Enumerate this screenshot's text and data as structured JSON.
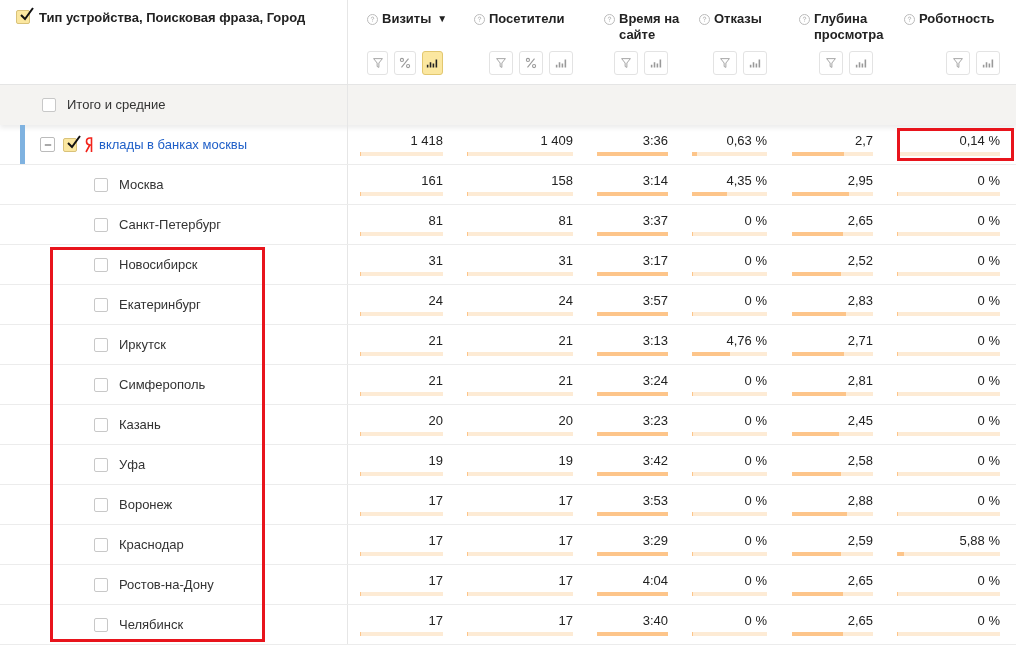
{
  "header": {
    "checked": true,
    "title": "Тип устройства, Поисковая фраза, Город",
    "columns": [
      {
        "label": "Визиты",
        "sort": "▼",
        "tools": [
          {
            "kind": "filter",
            "selected": false
          },
          {
            "kind": "percent",
            "selected": false
          },
          {
            "kind": "bars",
            "selected": true
          }
        ]
      },
      {
        "label": "Посетители",
        "tools": [
          {
            "kind": "filter",
            "selected": false
          },
          {
            "kind": "percent",
            "selected": false
          },
          {
            "kind": "bars",
            "selected": false
          }
        ]
      },
      {
        "label": "Время на сайте",
        "tools": [
          {
            "kind": "filter",
            "selected": false
          },
          {
            "kind": "bars",
            "selected": false
          }
        ]
      },
      {
        "label": "Отказы",
        "tools": [
          {
            "kind": "filter",
            "selected": false
          },
          {
            "kind": "bars",
            "selected": false
          }
        ]
      },
      {
        "label": "Глубина просмотра",
        "tools": [
          {
            "kind": "filter",
            "selected": false
          },
          {
            "kind": "bars",
            "selected": false
          }
        ]
      },
      {
        "label": "Роботность",
        "tools": [
          {
            "kind": "filter",
            "selected": false
          },
          {
            "kind": "bars",
            "selected": false
          }
        ]
      }
    ]
  },
  "totals": {
    "label": "Итого и средние",
    "checked": false
  },
  "rows": [
    {
      "kind": "phrase",
      "label": "вклады в банках москвы",
      "checked": true,
      "expanded": true,
      "framed": false,
      "cells": [
        {
          "value": "1 418",
          "level": 0
        },
        {
          "value": "1 409",
          "level": 0
        },
        {
          "value": "3:36",
          "level": 1
        },
        {
          "value": "0,63 %",
          "level": 0.07
        },
        {
          "value": "2,7",
          "level": 0.64
        },
        {
          "value": "0,14 %",
          "level": 0,
          "framed": true
        }
      ]
    },
    {
      "kind": "city",
      "label": "Москва",
      "checked": false,
      "framed": false,
      "cells": [
        {
          "value": "161",
          "level": 0
        },
        {
          "value": "158",
          "level": 0
        },
        {
          "value": "3:14",
          "level": 1
        },
        {
          "value": "4,35 %",
          "level": 0.47
        },
        {
          "value": "2,95",
          "level": 0.7
        },
        {
          "value": "0 %",
          "level": 0
        }
      ]
    },
    {
      "kind": "city",
      "label": "Санкт-Петербург",
      "checked": false,
      "framed": false,
      "cells": [
        {
          "value": "81",
          "level": 0
        },
        {
          "value": "81",
          "level": 0
        },
        {
          "value": "3:37",
          "level": 1
        },
        {
          "value": "0 %",
          "level": 0
        },
        {
          "value": "2,65",
          "level": 0.63
        },
        {
          "value": "0 %",
          "level": 0
        }
      ]
    },
    {
      "kind": "city",
      "label": "Новосибирск",
      "checked": false,
      "framed": true,
      "cells": [
        {
          "value": "31",
          "level": 0
        },
        {
          "value": "31",
          "level": 0
        },
        {
          "value": "3:17",
          "level": 1
        },
        {
          "value": "0 %",
          "level": 0
        },
        {
          "value": "2,52",
          "level": 0.6
        },
        {
          "value": "0 %",
          "level": 0
        }
      ]
    },
    {
      "kind": "city",
      "label": "Екатеринбург",
      "checked": false,
      "framed": true,
      "cells": [
        {
          "value": "24",
          "level": 0
        },
        {
          "value": "24",
          "level": 0
        },
        {
          "value": "3:57",
          "level": 1
        },
        {
          "value": "0 %",
          "level": 0
        },
        {
          "value": "2,83",
          "level": 0.67
        },
        {
          "value": "0 %",
          "level": 0
        }
      ]
    },
    {
      "kind": "city",
      "label": "Иркутск",
      "checked": false,
      "framed": true,
      "cells": [
        {
          "value": "21",
          "level": 0
        },
        {
          "value": "21",
          "level": 0
        },
        {
          "value": "3:13",
          "level": 1
        },
        {
          "value": "4,76 %",
          "level": 0.5
        },
        {
          "value": "2,71",
          "level": 0.64
        },
        {
          "value": "0 %",
          "level": 0
        }
      ]
    },
    {
      "kind": "city",
      "label": "Симферополь",
      "checked": false,
      "framed": true,
      "cells": [
        {
          "value": "21",
          "level": 0
        },
        {
          "value": "21",
          "level": 0
        },
        {
          "value": "3:24",
          "level": 1
        },
        {
          "value": "0 %",
          "level": 0
        },
        {
          "value": "2,81",
          "level": 0.67
        },
        {
          "value": "0 %",
          "level": 0
        }
      ]
    },
    {
      "kind": "city",
      "label": "Казань",
      "checked": false,
      "framed": true,
      "cells": [
        {
          "value": "20",
          "level": 0
        },
        {
          "value": "20",
          "level": 0
        },
        {
          "value": "3:23",
          "level": 1
        },
        {
          "value": "0 %",
          "level": 0
        },
        {
          "value": "2,45",
          "level": 0.58
        },
        {
          "value": "0 %",
          "level": 0
        }
      ]
    },
    {
      "kind": "city",
      "label": "Уфа",
      "checked": false,
      "framed": true,
      "cells": [
        {
          "value": "19",
          "level": 0
        },
        {
          "value": "19",
          "level": 0
        },
        {
          "value": "3:42",
          "level": 1
        },
        {
          "value": "0 %",
          "level": 0
        },
        {
          "value": "2,58",
          "level": 0.61
        },
        {
          "value": "0 %",
          "level": 0
        }
      ]
    },
    {
      "kind": "city",
      "label": "Воронеж",
      "checked": false,
      "framed": true,
      "cells": [
        {
          "value": "17",
          "level": 0
        },
        {
          "value": "17",
          "level": 0
        },
        {
          "value": "3:53",
          "level": 1
        },
        {
          "value": "0 %",
          "level": 0
        },
        {
          "value": "2,88",
          "level": 0.68
        },
        {
          "value": "0 %",
          "level": 0
        }
      ]
    },
    {
      "kind": "city",
      "label": "Краснодар",
      "checked": false,
      "framed": true,
      "cells": [
        {
          "value": "17",
          "level": 0
        },
        {
          "value": "17",
          "level": 0
        },
        {
          "value": "3:29",
          "level": 1
        },
        {
          "value": "0 %",
          "level": 0
        },
        {
          "value": "2,59",
          "level": 0.61
        },
        {
          "value": "5,88 %",
          "level": 0.07
        }
      ]
    },
    {
      "kind": "city",
      "label": "Ростов-на-Дону",
      "checked": false,
      "framed": true,
      "cells": [
        {
          "value": "17",
          "level": 0
        },
        {
          "value": "17",
          "level": 0
        },
        {
          "value": "4:04",
          "level": 1
        },
        {
          "value": "0 %",
          "level": 0
        },
        {
          "value": "2,65",
          "level": 0.63
        },
        {
          "value": "0 %",
          "level": 0
        }
      ]
    },
    {
      "kind": "city",
      "label": "Челябинск",
      "checked": false,
      "framed": true,
      "cells": [
        {
          "value": "17",
          "level": 0
        },
        {
          "value": "17",
          "level": 0
        },
        {
          "value": "3:40",
          "level": 1
        },
        {
          "value": "0 %",
          "level": 0
        },
        {
          "value": "2,65",
          "level": 0.63
        },
        {
          "value": "0 %",
          "level": 0
        }
      ]
    }
  ]
}
